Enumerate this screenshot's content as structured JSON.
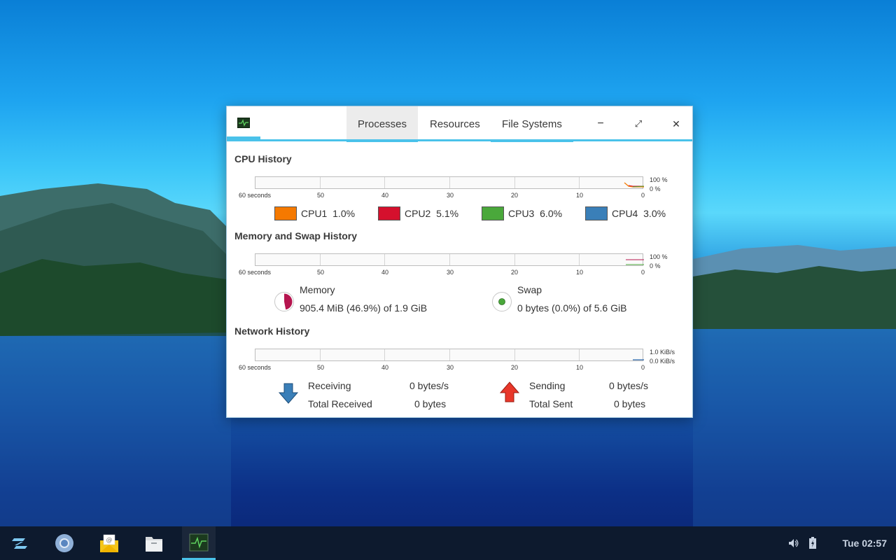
{
  "window": {
    "tabs": [
      {
        "label": "Processes"
      },
      {
        "label": "Resources"
      },
      {
        "label": "File Systems"
      }
    ],
    "controls": {
      "minimize": "−",
      "maximize": "⤢",
      "close": "✕"
    }
  },
  "cpu": {
    "title": "CPU History",
    "axis": {
      "left": "60 seconds",
      "ticks": [
        "50",
        "40",
        "30",
        "20",
        "10",
        "0"
      ],
      "max": "100 %",
      "min": "0 %"
    },
    "legend": [
      {
        "label": "CPU1",
        "value": "1.0%",
        "color": "#f57900"
      },
      {
        "label": "CPU2",
        "value": "5.1%",
        "color": "#d5102d"
      },
      {
        "label": "CPU3",
        "value": "6.0%",
        "color": "#4aa83b"
      },
      {
        "label": "CPU4",
        "value": "3.0%",
        "color": "#3a7fb8"
      }
    ]
  },
  "memory": {
    "title": "Memory and Swap History",
    "axis": {
      "left": "60 seconds",
      "ticks": [
        "50",
        "40",
        "30",
        "20",
        "10",
        "0"
      ],
      "max": "100 %",
      "min": "0 %"
    },
    "mem_label": "Memory",
    "mem_value": "905.4 MiB (46.9%) of 1.9 GiB",
    "mem_fraction": 0.469,
    "mem_color": "#b5154f",
    "swap_label": "Swap",
    "swap_value": "0 bytes (0.0%) of 5.6 GiB",
    "swap_color": "#4aa83b"
  },
  "network": {
    "title": "Network History",
    "axis": {
      "left": "60 seconds",
      "ticks": [
        "50",
        "40",
        "30",
        "20",
        "10",
        "0"
      ],
      "max": "1.0 KiB/s",
      "min": "0.0 KiB/s"
    },
    "receiving_label": "Receiving",
    "receiving_value": "0 bytes/s",
    "total_received_label": "Total Received",
    "total_received_value": "0 bytes",
    "sending_label": "Sending",
    "sending_value": "0 bytes/s",
    "total_sent_label": "Total Sent",
    "total_sent_value": "0 bytes"
  },
  "taskbar": {
    "items": [
      {
        "name": "zorin-menu-icon"
      },
      {
        "name": "chromium-icon"
      },
      {
        "name": "mail-icon"
      },
      {
        "name": "files-icon"
      },
      {
        "name": "system-monitor-icon"
      }
    ],
    "clock": "Tue 02:57"
  }
}
